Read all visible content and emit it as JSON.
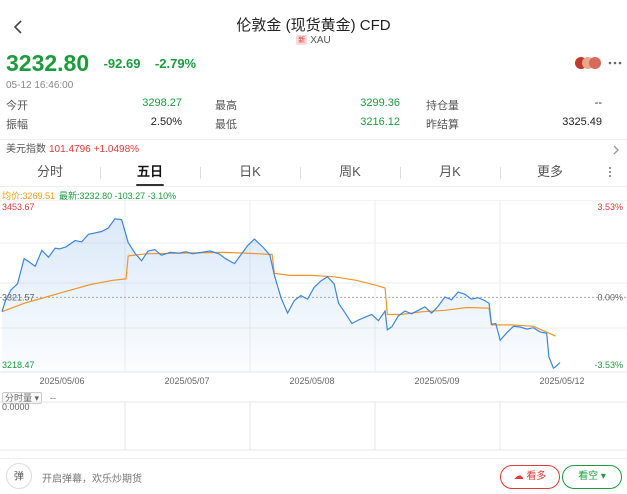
{
  "header": {
    "title": "伦敦金 (现货黄金) CFD",
    "badge": "新",
    "symbol": "XAU"
  },
  "quote": {
    "price": "3232.80",
    "change": "-92.69",
    "change_pct": "-2.79%",
    "time": "05-12 16:46:00"
  },
  "stats": {
    "open_label": "今开",
    "open_value": "3298.27",
    "high_label": "最高",
    "high_value": "3299.36",
    "position_label": "持仓量",
    "position_value": "--",
    "amplitude_label": "振幅",
    "amplitude_value": "2.50%",
    "low_label": "最低",
    "low_value": "3216.12",
    "prev_settle_label": "昨结算",
    "prev_settle_value": "3325.49"
  },
  "index_bar": {
    "name": "美元指数",
    "value": "101.4796",
    "change": "+1.0498%"
  },
  "tabs": [
    "分时",
    "五日",
    "日K",
    "周K",
    "月K",
    "更多"
  ],
  "active_tab": "五日",
  "legend": {
    "avg": "均价:3269.51",
    "latest": "最新:3232.80 -103.27 -3.10%"
  },
  "chart_data": {
    "type": "line",
    "y_ticks_left": [
      "3453.67",
      "3321.57",
      "3218.47"
    ],
    "y_ticks_right": [
      "3.53%",
      "0.00%",
      "-3.53%"
    ],
    "x_ticks": [
      "2025/05/06",
      "2025/05/07",
      "2025/05/08",
      "2025/05/09",
      "2025/05/12"
    ],
    "ylim": [
      3218.47,
      3453.67
    ],
    "baseline": 3325.49,
    "grid": true,
    "series": [
      {
        "name": "最新",
        "color": "#3a86e0",
        "points": [
          [
            0,
            3305
          ],
          [
            0.15,
            3320
          ],
          [
            0.4,
            3336
          ],
          [
            0.7,
            3345
          ],
          [
            1.0,
            3381
          ],
          [
            1.2,
            3377
          ],
          [
            1.5,
            3370
          ],
          [
            1.8,
            3393
          ],
          [
            2.1,
            3383
          ],
          [
            2.4,
            3396
          ],
          [
            2.6,
            3395
          ],
          [
            2.9,
            3398
          ],
          [
            3.3,
            3407
          ],
          [
            3.6,
            3405
          ],
          [
            3.9,
            3416
          ],
          [
            4.2,
            3418
          ],
          [
            4.5,
            3420
          ],
          [
            4.8,
            3425
          ],
          [
            5.1,
            3438
          ],
          [
            5.4,
            3437
          ],
          [
            5.7,
            3404
          ],
          [
            6.0,
            3389
          ],
          [
            6.3,
            3378
          ],
          [
            6.6,
            3392
          ],
          [
            6.9,
            3394
          ],
          [
            7.2,
            3386
          ],
          [
            7.6,
            3390
          ],
          [
            8.0,
            3389
          ],
          [
            8.3,
            3391
          ],
          [
            8.6,
            3388
          ],
          [
            9.0,
            3390
          ],
          [
            9.4,
            3392
          ],
          [
            9.8,
            3388
          ],
          [
            10.1,
            3381
          ],
          [
            10.5,
            3374
          ],
          [
            10.8,
            3387
          ],
          [
            11.1,
            3400
          ],
          [
            11.4,
            3409
          ],
          [
            11.8,
            3397
          ],
          [
            12.1,
            3386
          ],
          [
            12.3,
            3357
          ],
          [
            12.6,
            3325
          ],
          [
            12.9,
            3303
          ],
          [
            13.2,
            3321
          ],
          [
            13.5,
            3328
          ],
          [
            13.8,
            3323
          ],
          [
            14.1,
            3340
          ],
          [
            14.4,
            3349
          ],
          [
            14.7,
            3355
          ],
          [
            15.0,
            3345
          ],
          [
            15.2,
            3317
          ],
          [
            15.5,
            3303
          ],
          [
            15.8,
            3288
          ],
          [
            16.1,
            3293
          ],
          [
            16.4,
            3297
          ],
          [
            16.7,
            3301
          ],
          [
            17.0,
            3292
          ],
          [
            17.3,
            3306
          ],
          [
            17.4,
            3279
          ],
          [
            17.6,
            3283
          ],
          [
            17.9,
            3299
          ],
          [
            18.2,
            3306
          ],
          [
            18.5,
            3302
          ],
          [
            18.8,
            3307
          ],
          [
            19.1,
            3312
          ],
          [
            19.4,
            3303
          ],
          [
            19.7,
            3313
          ],
          [
            20.0,
            3326
          ],
          [
            20.3,
            3322
          ],
          [
            20.6,
            3333
          ],
          [
            20.9,
            3330
          ],
          [
            21.2,
            3323
          ],
          [
            21.5,
            3325
          ],
          [
            21.8,
            3321
          ],
          [
            22.0,
            3317
          ],
          [
            22.1,
            3287
          ],
          [
            22.3,
            3288
          ],
          [
            22.5,
            3264
          ],
          [
            22.8,
            3275
          ],
          [
            23.1,
            3284
          ],
          [
            23.4,
            3283
          ],
          [
            23.7,
            3280
          ],
          [
            24.0,
            3282
          ],
          [
            24.3,
            3276
          ],
          [
            24.6,
            3274
          ],
          [
            24.7,
            3240
          ],
          [
            24.9,
            3224
          ],
          [
            25.0,
            3226
          ],
          [
            25.2,
            3232
          ]
        ]
      },
      {
        "name": "均价",
        "color": "#f0952a",
        "points": [
          [
            0,
            3305
          ],
          [
            1,
            3317
          ],
          [
            2,
            3326
          ],
          [
            3,
            3335
          ],
          [
            4,
            3344
          ],
          [
            5,
            3350
          ],
          [
            5.6,
            3352
          ],
          [
            5.7,
            3385
          ],
          [
            6.5,
            3388
          ],
          [
            8,
            3389
          ],
          [
            10,
            3390
          ],
          [
            11,
            3389
          ],
          [
            12.2,
            3387
          ],
          [
            12.3,
            3360
          ],
          [
            13,
            3357
          ],
          [
            14,
            3357
          ],
          [
            15,
            3355
          ],
          [
            16,
            3350
          ],
          [
            17,
            3342
          ],
          [
            17.3,
            3339
          ],
          [
            17.4,
            3301
          ],
          [
            18,
            3301
          ],
          [
            19,
            3305
          ],
          [
            20,
            3307
          ],
          [
            21,
            3311
          ],
          [
            22,
            3310
          ],
          [
            22.1,
            3286
          ],
          [
            23,
            3286
          ],
          [
            24,
            3284
          ],
          [
            25,
            3270
          ]
        ]
      }
    ]
  },
  "volume": {
    "label": "分时量",
    "value": "--",
    "y_tick": "0.0000"
  },
  "bottom": {
    "danmu_text": "开启弹幕，欢乐炒期货",
    "bull_label": "看多",
    "bear_label": "看空"
  },
  "colors": {
    "up": "#e23a3a",
    "down": "#1a9c3d",
    "price_line": "#3a86e0",
    "avg_line": "#f0952a"
  }
}
